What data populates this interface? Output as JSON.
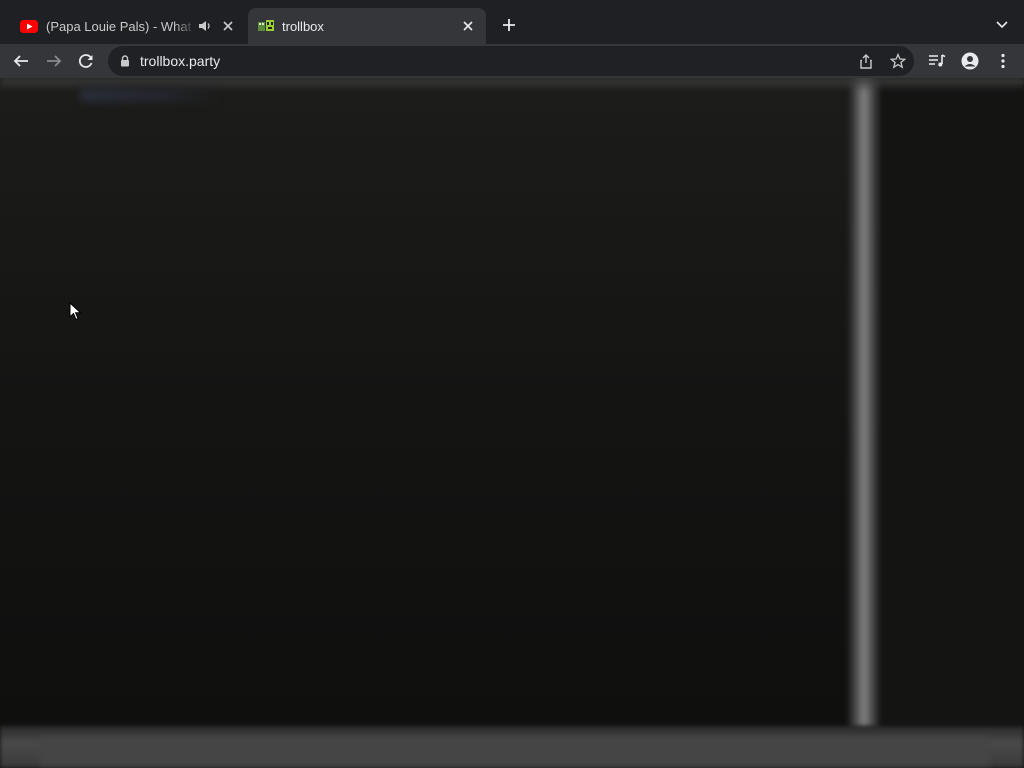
{
  "browser": {
    "tabs": [
      {
        "title": "(Papa Louie Pals) - What do",
        "favicon": "youtube-icon",
        "audio": true,
        "active": false
      },
      {
        "title": "trollbox",
        "favicon": "trollbox-icon",
        "audio": false,
        "active": true
      }
    ],
    "address": {
      "url": "trollbox.party",
      "secure": true
    },
    "toolbar_icons": [
      "back-icon",
      "forward-icon",
      "reload-icon",
      "share-icon",
      "star-icon",
      "media-icon",
      "profile-icon",
      "menu-icon"
    ]
  },
  "colors": {
    "tabstrip": "#1f2023",
    "active_tab": "#35363a",
    "omnibox": "#202124",
    "youtube_red": "#ff0000"
  }
}
